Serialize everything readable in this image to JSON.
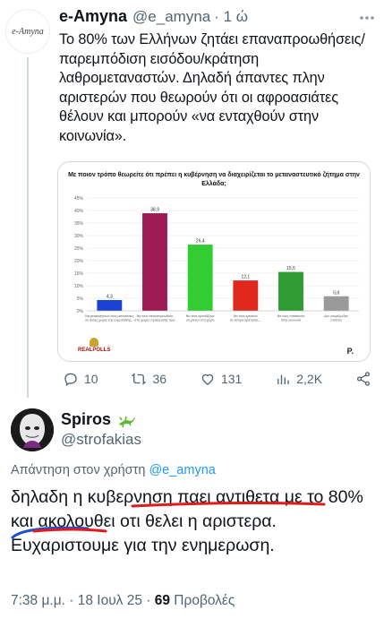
{
  "tweet": {
    "avatar_text": "e-Amyna",
    "author_name": "e-Amyna",
    "handle": "@e_amyna",
    "time": "· 1 ώ",
    "more_icon": "more-dots-icon",
    "text": "Το 80% των Ελλήνων ζητάει επαναπροωθήσεις/παρεμπόδιση εισόδου/κράτηση λαθρομεταναστών. Δηλαδή άπαντες πλην αριστερών που θεωρούν ότι οι αφροασιάτες θέλουν και μπορούν «να ενταχθούν στην κοινωνία».",
    "actions": {
      "replies": "10",
      "retweets": "36",
      "likes": "131",
      "views": "2,2K"
    }
  },
  "chart_data": {
    "type": "bar",
    "title": "Με ποιον τρόπο θεωρείτε ότι πρέπει η κυβέρνηση να διαχειρίζεται το μεταναστευτικό ζήτημα στην Ελλάδα;",
    "ylim": [
      0,
      45
    ],
    "yticks": [
      "0%",
      "5%",
      "10%",
      "15%",
      "20%",
      "25%",
      "30%",
      "35%",
      "40%",
      "45%"
    ],
    "categories": [
      "Να μετακινήσουν τους μετανάστες σε άλλες χώρες της ευρωπαϊκής...",
      "Να τους επαναπροωθούν στις χώρες προέλευσής τους",
      "Να τους εμποδίζουν να μπουν στη χώρα",
      "Να τους κρατούν σε κέντρα κράτησης...",
      "Να τους εντάσσουν στην κοινωνία",
      "Δεν γνωρίζω/Δεν απαντώ"
    ],
    "values": [
      4.3,
      38.9,
      26.4,
      12.1,
      15.5,
      5.8
    ],
    "value_labels": [
      "4,3",
      "38,9",
      "26,4",
      "12,1",
      "15,5",
      "5,8"
    ],
    "colors": [
      "#1a43d6",
      "#9b1b52",
      "#33cc33",
      "#e0281e",
      "#2f9c33",
      "#9a9a9a"
    ],
    "brand": "REALPOLLS",
    "brand_mark": "P."
  },
  "reply": {
    "name": "Spiros",
    "emoji_icon": "lizard-icon",
    "handle": "@strofakias",
    "reply_prefix": "Απάντηση στον χρήστη ",
    "reply_target": "@e_amyna",
    "text": "δηλαδη η κυβερνηση παει αντιθετα με το 80% και ακολουθει οτι θελει η αριστερα. Ευχαριστουμε για την ενημερωση.",
    "time_date": "7:38 μ.μ. · 18 Ιουλ 25 · ",
    "views_count": "69",
    "views_label": " Προβολές"
  }
}
